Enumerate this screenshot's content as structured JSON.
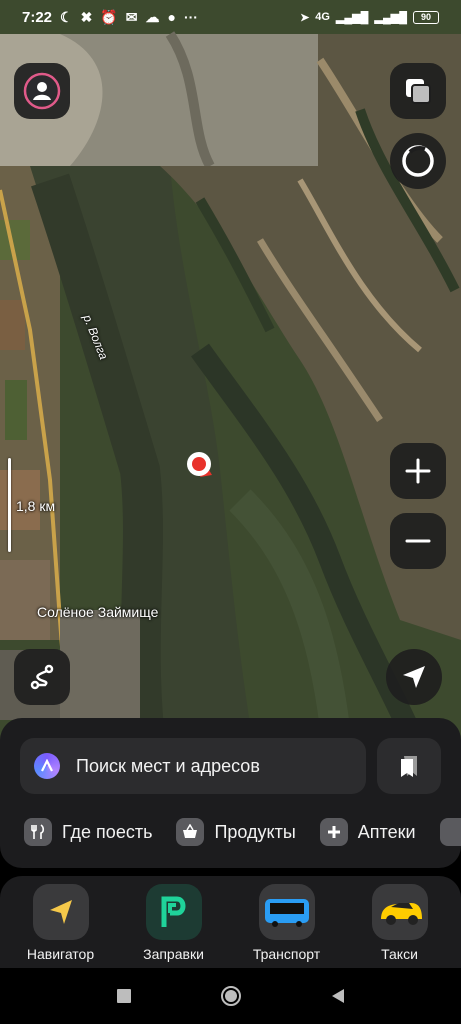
{
  "status_bar": {
    "time": "7:22",
    "network": "4G",
    "battery": "90"
  },
  "map": {
    "river_label": "р. Волга",
    "town_label": "Солёное Займище",
    "scale_label": "1,8 км"
  },
  "search": {
    "placeholder": "Поиск мест и адресов"
  },
  "chips": [
    {
      "label": "Где поесть",
      "icon": "fork-knife-icon"
    },
    {
      "label": "Продукты",
      "icon": "basket-icon"
    },
    {
      "label": "Аптеки",
      "icon": "plus-icon"
    }
  ],
  "services": [
    {
      "label": "Навигатор",
      "icon": "navigator-arrow-icon",
      "color": "#f5c84a"
    },
    {
      "label": "Заправки",
      "icon": "fuel-p-icon",
      "color": "#1fd39a"
    },
    {
      "label": "Транспорт",
      "icon": "bus-icon",
      "color": "#2a9df4"
    },
    {
      "label": "Такси",
      "icon": "taxi-car-icon",
      "color": "#ffcc00"
    }
  ],
  "colors": {
    "accent_pin": "#e8322b",
    "sheet_bg": "#1c1c1e",
    "field_bg": "#2c2c2e"
  }
}
